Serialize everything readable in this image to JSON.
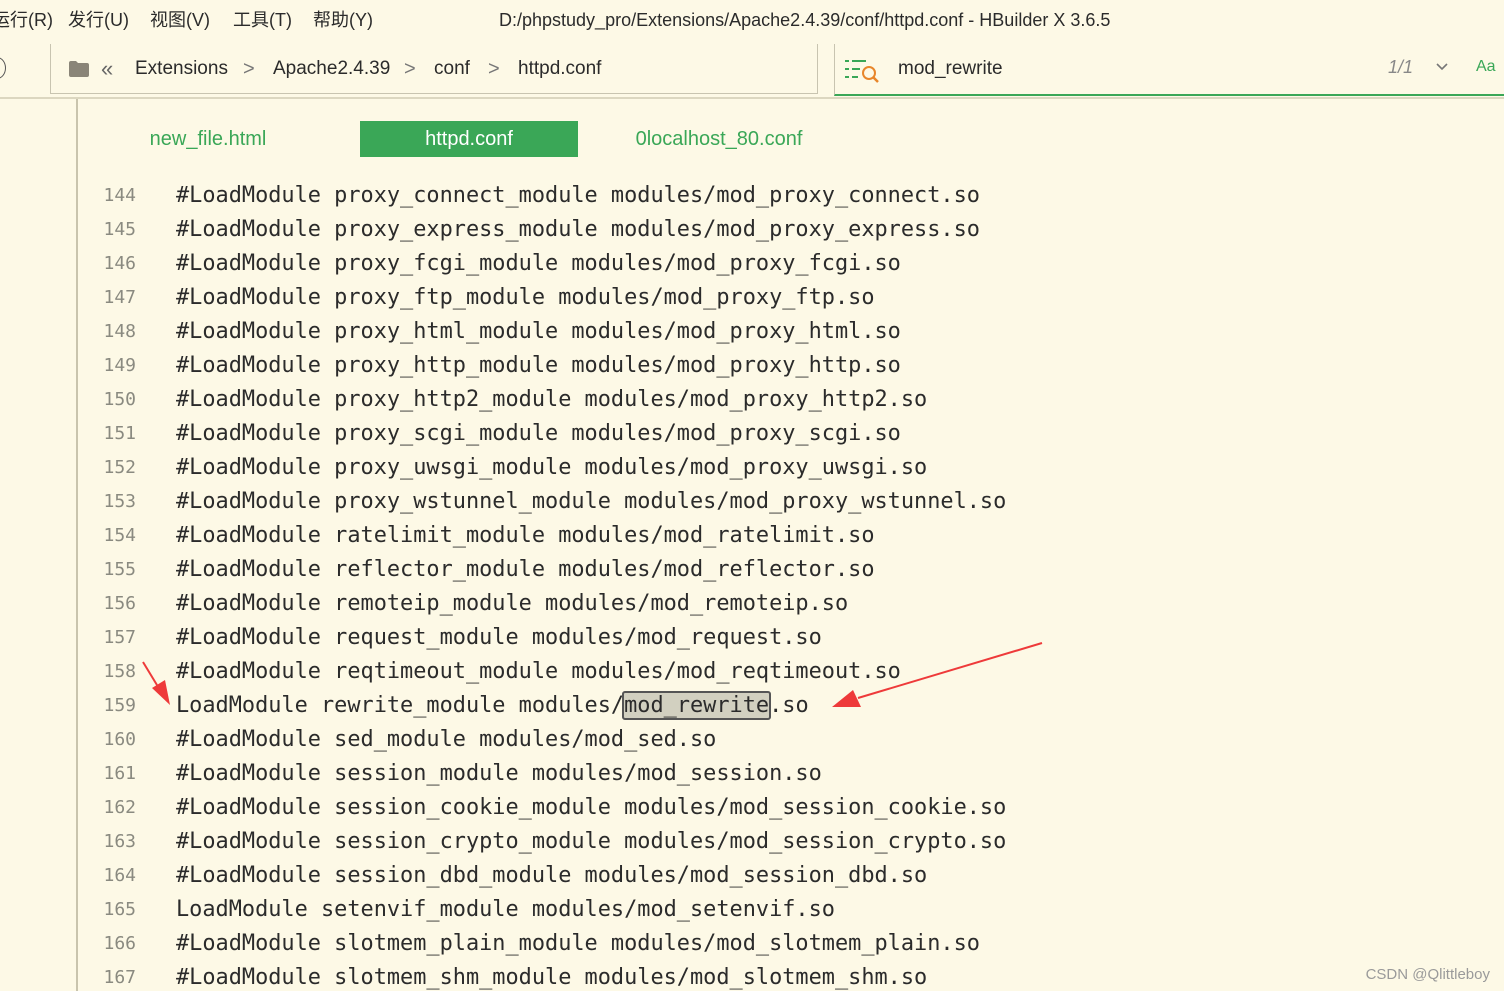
{
  "menu": {
    "run": "运行(R)",
    "publish": "发行(U)",
    "view": "视图(V)",
    "tools": "工具(T)",
    "help": "帮助(Y)"
  },
  "window_title": "D:/phpstudy_pro/Extensions/Apache2.4.39/conf/httpd.conf - HBuilder X 3.6.5",
  "breadcrumb": {
    "back_symbol": "«",
    "items": [
      "Extensions",
      "Apache2.4.39",
      "conf",
      "httpd.conf"
    ],
    "separator": ">"
  },
  "search": {
    "query": "mod_rewrite",
    "match_count": "1/1",
    "case_toggle": "Aa"
  },
  "tabs": [
    {
      "label": "new_file.html",
      "active": false
    },
    {
      "label": "httpd.conf",
      "active": true
    },
    {
      "label": "0localhost_80.conf",
      "active": false
    }
  ],
  "code_lines": [
    {
      "no": "144",
      "text": "#LoadModule proxy_connect_module modules/mod_proxy_connect.so"
    },
    {
      "no": "145",
      "text": "#LoadModule proxy_express_module modules/mod_proxy_express.so"
    },
    {
      "no": "146",
      "text": "#LoadModule proxy_fcgi_module modules/mod_proxy_fcgi.so"
    },
    {
      "no": "147",
      "text": "#LoadModule proxy_ftp_module modules/mod_proxy_ftp.so"
    },
    {
      "no": "148",
      "text": "#LoadModule proxy_html_module modules/mod_proxy_html.so"
    },
    {
      "no": "149",
      "text": "#LoadModule proxy_http_module modules/mod_proxy_http.so"
    },
    {
      "no": "150",
      "text": "#LoadModule proxy_http2_module modules/mod_proxy_http2.so"
    },
    {
      "no": "151",
      "text": "#LoadModule proxy_scgi_module modules/mod_proxy_scgi.so"
    },
    {
      "no": "152",
      "text": "#LoadModule proxy_uwsgi_module modules/mod_proxy_uwsgi.so"
    },
    {
      "no": "153",
      "text": "#LoadModule proxy_wstunnel_module modules/mod_proxy_wstunnel.so"
    },
    {
      "no": "154",
      "text": "#LoadModule ratelimit_module modules/mod_ratelimit.so"
    },
    {
      "no": "155",
      "text": "#LoadModule reflector_module modules/mod_reflector.so"
    },
    {
      "no": "156",
      "text": "#LoadModule remoteip_module modules/mod_remoteip.so"
    },
    {
      "no": "157",
      "text": "#LoadModule request_module modules/mod_request.so"
    },
    {
      "no": "158",
      "text": "#LoadModule reqtimeout_module modules/mod_reqtimeout.so"
    },
    {
      "no": "159",
      "before": "LoadModule rewrite_module modules/",
      "match": "mod_rewrite",
      "after": ".so"
    },
    {
      "no": "160",
      "text": "#LoadModule sed_module modules/mod_sed.so"
    },
    {
      "no": "161",
      "text": "#LoadModule session_module modules/mod_session.so"
    },
    {
      "no": "162",
      "text": "#LoadModule session_cookie_module modules/mod_session_cookie.so"
    },
    {
      "no": "163",
      "text": "#LoadModule session_crypto_module modules/mod_session_crypto.so"
    },
    {
      "no": "164",
      "text": "#LoadModule session_dbd_module modules/mod_session_dbd.so"
    },
    {
      "no": "165",
      "text": "LoadModule setenvif_module modules/mod_setenvif.so"
    },
    {
      "no": "166",
      "text": "#LoadModule slotmem_plain_module modules/mod_slotmem_plain.so"
    },
    {
      "no": "167",
      "text": "#LoadModule slotmem_shm_module modules/mod_slotmem_shm.so"
    }
  ],
  "colors": {
    "accent": "#3aa757",
    "background": "#fdf9e6",
    "annotation_arrow": "#ee3a3a"
  },
  "watermark": "CSDN @Qlittleboy"
}
